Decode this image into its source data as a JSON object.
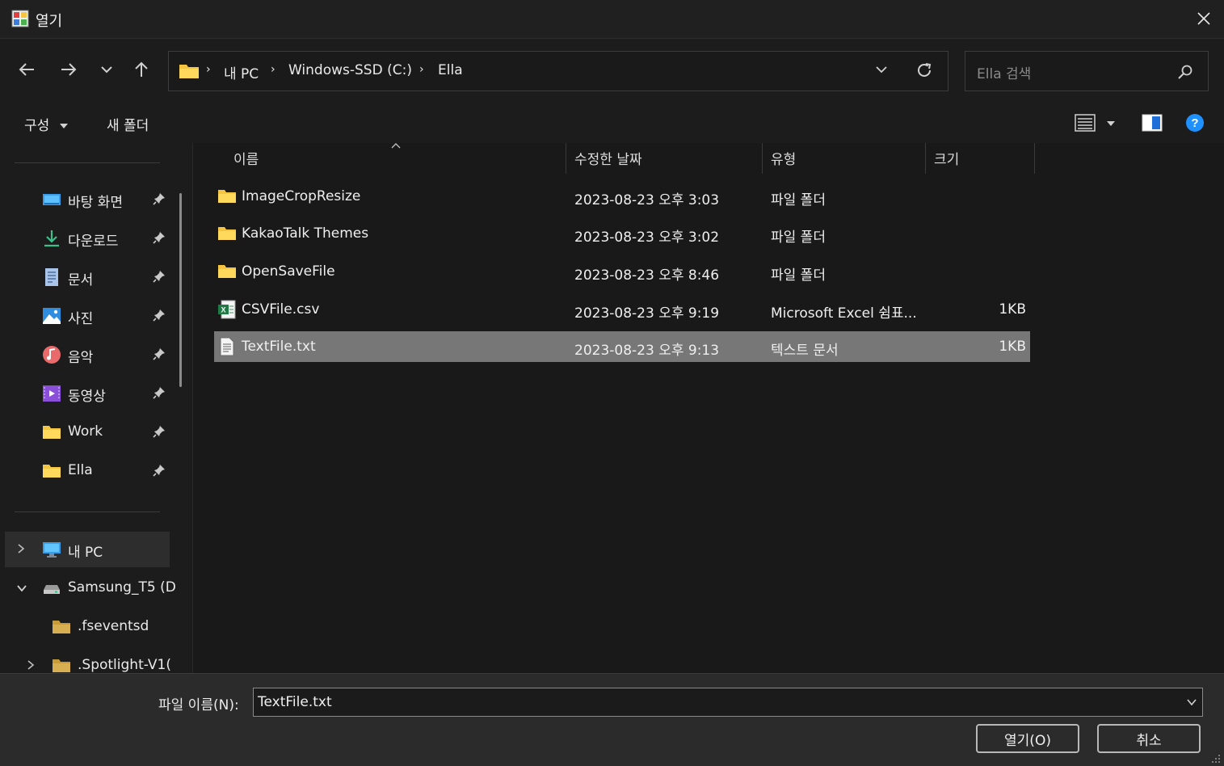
{
  "window": {
    "title": "열기"
  },
  "nav": {
    "breadcrumbs": [
      "내 PC",
      "Windows-SSD (C:)",
      "Ella"
    ],
    "search_placeholder": "Ella 검색"
  },
  "toolbar": {
    "organize_label": "구성",
    "new_folder_label": "새 폴더"
  },
  "sidebar": {
    "quick_access": [
      {
        "label": "바탕 화면",
        "icon": "desktop-icon"
      },
      {
        "label": "다운로드",
        "icon": "download-icon"
      },
      {
        "label": "문서",
        "icon": "document-icon"
      },
      {
        "label": "사진",
        "icon": "pictures-icon"
      },
      {
        "label": "음악",
        "icon": "music-icon"
      },
      {
        "label": "동영상",
        "icon": "video-icon"
      },
      {
        "label": "Work",
        "icon": "folder-icon"
      },
      {
        "label": "Ella",
        "icon": "folder-icon"
      }
    ],
    "tree": [
      {
        "label": "내 PC",
        "icon": "pc-icon"
      },
      {
        "label": "Samsung_T5 (D",
        "icon": "drive-icon"
      },
      {
        "label": ".fseventsd",
        "icon": "folder-icon"
      },
      {
        "label": ".Spotlight-V1(",
        "icon": "folder-icon"
      }
    ]
  },
  "columns": {
    "name": "이름",
    "date": "수정한 날짜",
    "type": "유형",
    "size": "크기"
  },
  "files": [
    {
      "name": "ImageCropResize",
      "date": "2023-08-23 오후 3:03",
      "type": "파일 폴더",
      "size": "",
      "icon": "folder-icon"
    },
    {
      "name": "KakaoTalk Themes",
      "date": "2023-08-23 오후 3:02",
      "type": "파일 폴더",
      "size": "",
      "icon": "folder-icon"
    },
    {
      "name": "OpenSaveFile",
      "date": "2023-08-23 오후 8:46",
      "type": "파일 폴더",
      "size": "",
      "icon": "folder-icon"
    },
    {
      "name": "CSVFile.csv",
      "date": "2023-08-23 오후 9:19",
      "type": "Microsoft Excel 쉼표...",
      "size": "1KB",
      "icon": "excel-csv-icon"
    },
    {
      "name": "TextFile.txt",
      "date": "2023-08-23 오후 9:13",
      "type": "텍스트 문서",
      "size": "1KB",
      "icon": "text-file-icon",
      "selected": true
    }
  ],
  "footer": {
    "filename_label": "파일 이름(N):",
    "filename_value": "TextFile.txt",
    "open_label": "열기(O)",
    "cancel_label": "취소"
  },
  "colors": {
    "background": "#1f1f1f",
    "selection": "#777777",
    "folder": "#f5c542",
    "help": "#1e90ff"
  }
}
